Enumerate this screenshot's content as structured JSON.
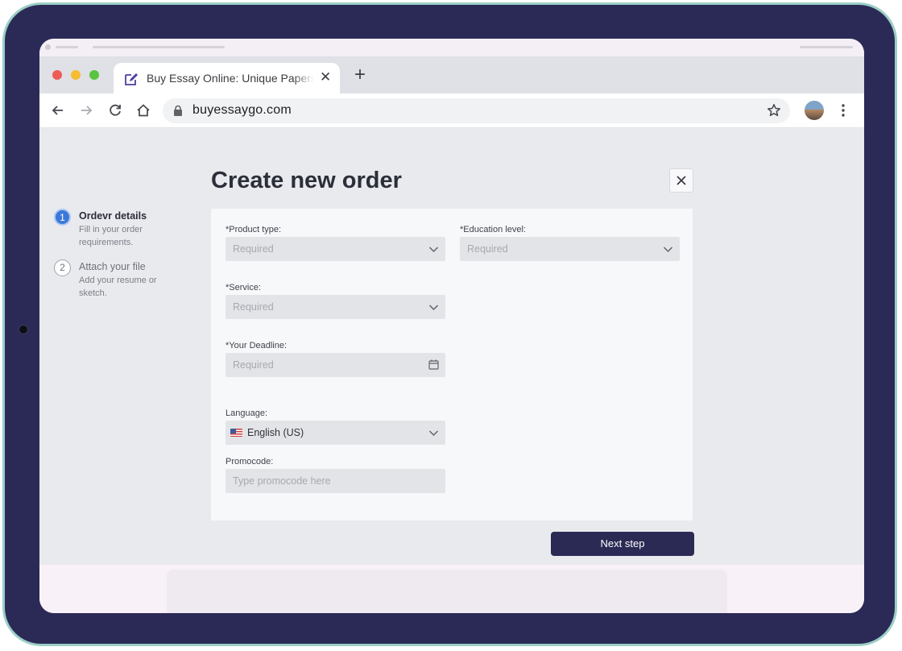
{
  "browser": {
    "tab": {
      "title": "Buy Essay Online: Unique Papers",
      "icon": "edit-icon"
    },
    "new_tab_icon": "plus-icon",
    "address": "buyessaygo.com",
    "window_controls": {
      "close_color": "#ed5b56",
      "minimize_color": "#f5bd2f",
      "maximize_color": "#5ac33f"
    }
  },
  "order": {
    "title": "Create new order",
    "steps": [
      {
        "number": "1",
        "title": "Ordevr details",
        "desc": "Fill in your order requirements.",
        "state": "active"
      },
      {
        "number": "2",
        "title": "Attach your file",
        "desc": "Add your resume or sketch.",
        "state": "inactive"
      }
    ],
    "fields": {
      "product_type": {
        "label": "*Product type:",
        "placeholder": "Required"
      },
      "education_level": {
        "label": "*Education level:",
        "placeholder": "Required"
      },
      "service": {
        "label": "*Service:",
        "placeholder": "Required"
      },
      "deadline": {
        "label": "*Your Deadline:",
        "placeholder": "Required"
      },
      "language": {
        "label": "Language:",
        "value": "English (US)"
      },
      "promocode": {
        "label": "Promocode:",
        "placeholder": "Type promocode here"
      }
    },
    "next_label": "Next step"
  },
  "colors": {
    "accent": "#2b2a55",
    "step_active": "#3a78d6",
    "frame": "#2b2a57",
    "frame_border": "#9dcfc6"
  }
}
